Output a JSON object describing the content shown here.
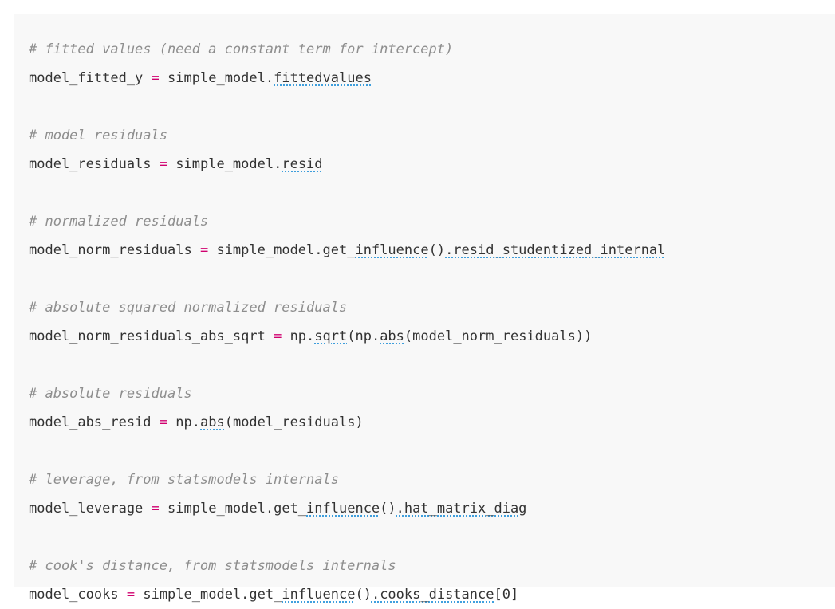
{
  "code": {
    "blocks": [
      {
        "comment": "# fitted values (need a constant term for intercept)",
        "var": "model_fitted_y",
        "eq": "=",
        "parts": [
          "simple_model.",
          "fittedvalues",
          ""
        ]
      },
      {
        "comment": "# model residuals",
        "var": "model_residuals",
        "eq": "=",
        "parts": [
          "simple_model.",
          "resid",
          ""
        ]
      },
      {
        "comment": "# normalized residuals",
        "var": "model_norm_residuals",
        "eq": "=",
        "parts": [
          "simple_model.get_",
          "influence",
          "()",
          ".resid_studentized_internal",
          ""
        ]
      },
      {
        "comment": "# absolute squared normalized residuals",
        "var": "model_norm_residuals_abs_sqrt",
        "eq": "=",
        "parts": [
          "np.",
          "sqrt",
          "(np.",
          "abs",
          "(model_norm_residuals))"
        ]
      },
      {
        "comment": "# absolute residuals",
        "var": "model_abs_resid",
        "eq": "=",
        "parts": [
          "np.",
          "abs",
          "(model_residuals)"
        ]
      },
      {
        "comment": "# leverage, from statsmodels internals",
        "var": "model_leverage",
        "eq": "=",
        "parts": [
          "simple_model.get_",
          "influence",
          "()",
          ".hat_matrix_diag",
          ""
        ]
      },
      {
        "comment": "# cook's distance, from statsmodels internals",
        "var": "model_cooks",
        "eq": "=",
        "parts": [
          "simple_model.get_",
          "influence",
          "()",
          ".cooks_distance",
          "[0]"
        ]
      }
    ]
  }
}
